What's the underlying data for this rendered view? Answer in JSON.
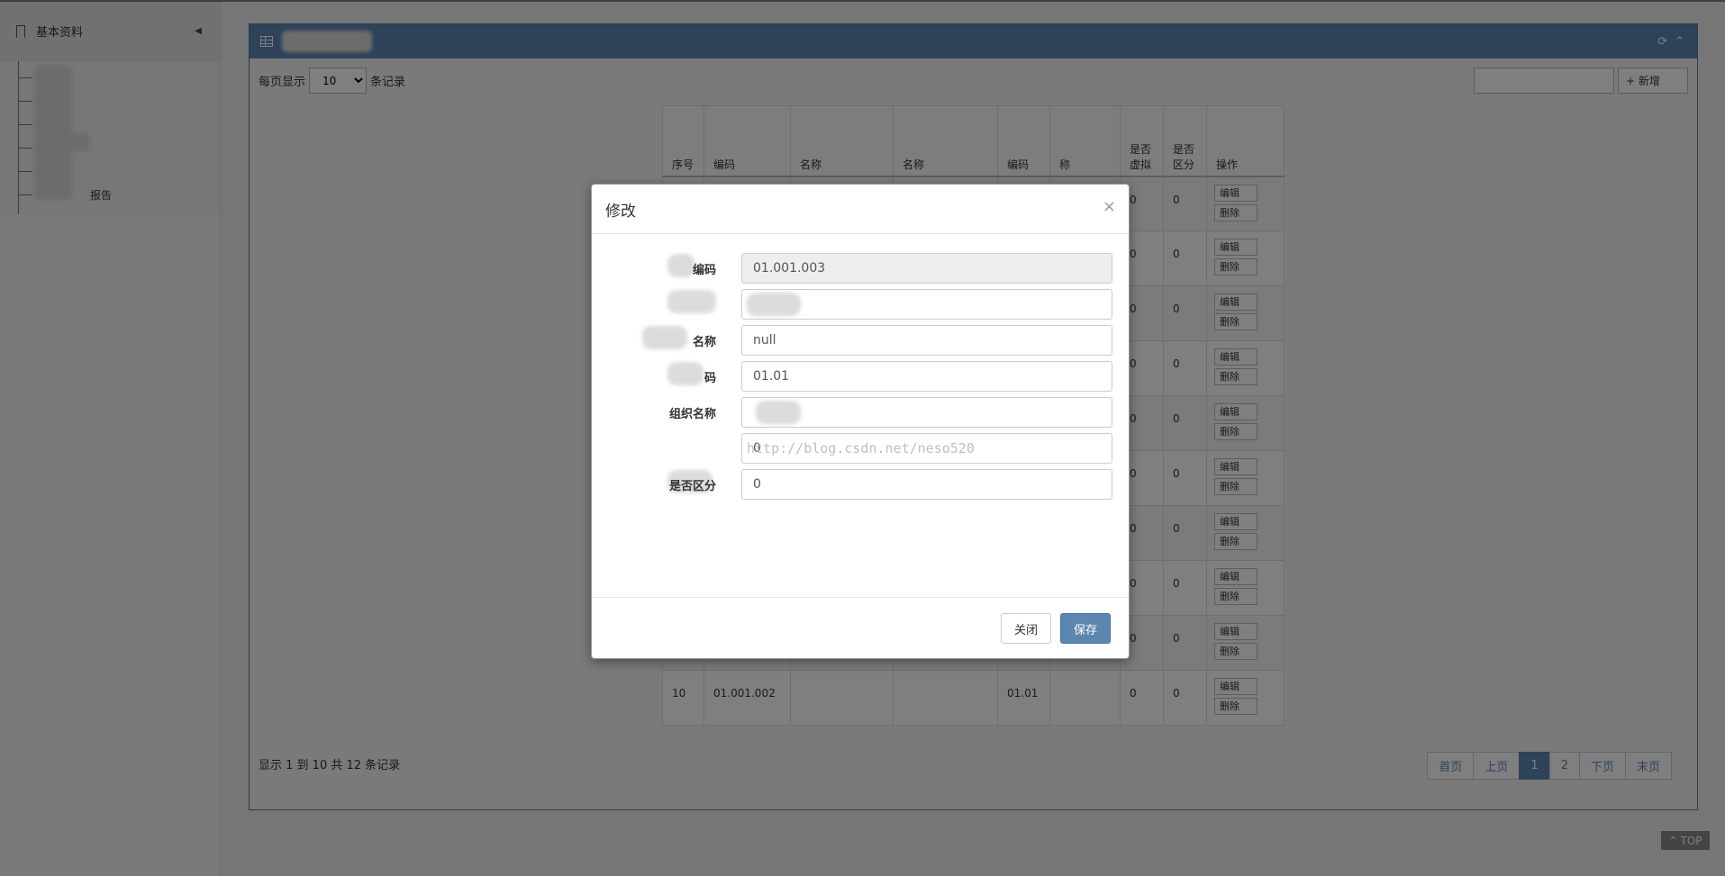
{
  "sidebar": {
    "section_title": "基本资料",
    "items": [
      {
        "label": ""
      },
      {
        "label": ""
      },
      {
        "label": ""
      },
      {
        "label": ""
      },
      {
        "label": ""
      },
      {
        "label": "报告"
      }
    ]
  },
  "panel": {
    "page_size_prefix": "每页显示",
    "page_size_value": "10",
    "page_size_suffix": "条记录",
    "add_label": "+ 新增",
    "columns": [
      "序号",
      "编码",
      "名称",
      "名称",
      "编码",
      "称",
      "是否虚拟",
      "是否区分",
      "操作"
    ],
    "rows": [
      {
        "values": [
          "",
          "",
          "",
          "",
          "",
          "",
          "0",
          "0"
        ]
      },
      {
        "values": [
          "",
          "",
          "",
          "",
          "",
          "",
          "0",
          "0"
        ]
      },
      {
        "values": [
          "",
          "",
          "",
          "",
          "",
          "",
          "0",
          "0"
        ]
      },
      {
        "values": [
          "",
          "",
          "",
          "",
          "",
          "",
          "0",
          "0"
        ]
      },
      {
        "values": [
          "",
          "",
          "",
          "",
          "",
          "",
          "0",
          "0"
        ]
      },
      {
        "values": [
          "",
          "",
          "",
          "",
          "",
          "",
          "0",
          "0"
        ]
      },
      {
        "values": [
          "",
          "",
          "",
          "",
          "",
          "",
          "0",
          "0"
        ]
      },
      {
        "values": [
          "",
          "",
          "",
          "",
          "",
          "",
          "0",
          "0"
        ]
      },
      {
        "values": [
          "",
          "",
          "",
          "",
          "",
          "",
          "0",
          "0"
        ]
      },
      {
        "values": [
          "10",
          "01.001.002",
          "",
          "",
          "01.01",
          "",
          "0",
          "0"
        ]
      }
    ],
    "edit_label": "编辑",
    "delete_label": "删除",
    "summary": "显示 1 到 10 共 12 条记录",
    "pager": [
      "首页",
      "上页",
      "1",
      "2",
      "下页",
      "末页"
    ],
    "top_label": "TOP"
  },
  "modal": {
    "title": "修改",
    "close_glyph": "×",
    "fields": [
      {
        "label": "编码",
        "value": "01.001.003"
      },
      {
        "label": "",
        "value": ""
      },
      {
        "label": "名称",
        "value": "null"
      },
      {
        "label": "码",
        "value": "01.01"
      },
      {
        "label": "组织名称",
        "value": ""
      },
      {
        "label": "",
        "value": "0"
      },
      {
        "label": "是否区分",
        "value": "0"
      }
    ],
    "watermark": "http://blog.csdn.net/neso520",
    "close_button": "关闭",
    "save_button": "保存"
  }
}
